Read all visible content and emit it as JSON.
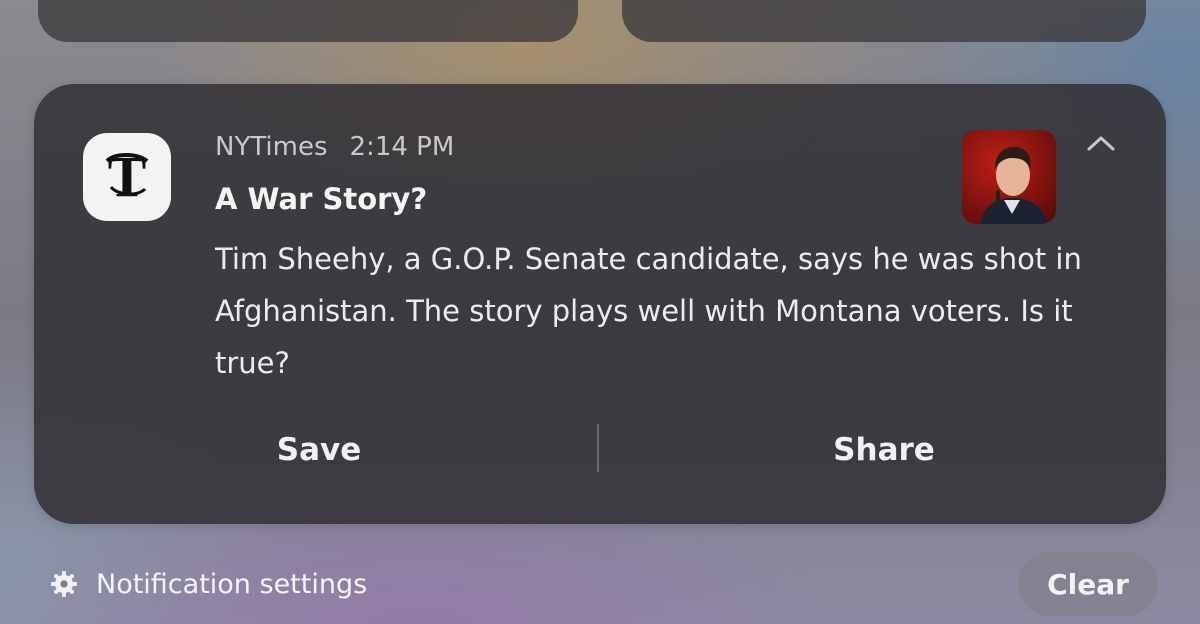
{
  "notification": {
    "app_name": "NYTimes",
    "time": "2:14 PM",
    "title": "A War Story?",
    "body": "Tim Sheehy, a G.O.P. Senate candidate, says he was shot in Afghanistan. The story plays well with Montana voters. Is it true?",
    "actions": {
      "save": "Save",
      "share": "Share"
    },
    "icons": {
      "app": "nytimes-logo-icon",
      "expand": "chevron-up-icon",
      "thumbnail": "photo-thumbnail"
    }
  },
  "footer": {
    "settings_label": "Notification settings",
    "settings_icon": "gear-icon",
    "clear_label": "Clear"
  },
  "colors": {
    "card_bg": "#323034",
    "accent_red": "#9f1612"
  }
}
